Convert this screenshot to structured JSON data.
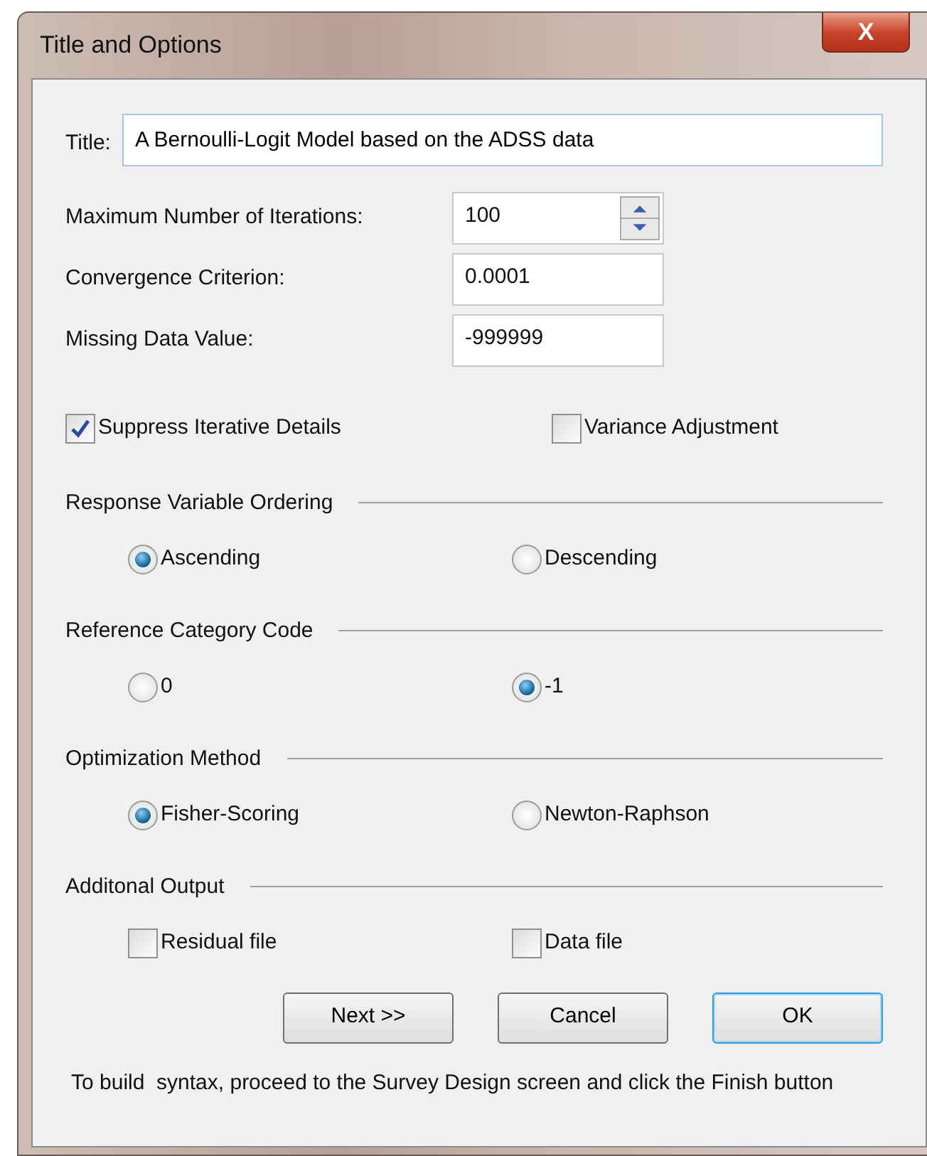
{
  "window": {
    "title": "Title and Options",
    "close_label": "X"
  },
  "title_field": {
    "label": "Title:",
    "value": "A Bernoulli-Logit Model based on the ADSS data"
  },
  "fields": [
    {
      "label": "Maximum Number of Iterations:",
      "value": "100",
      "kind": "spinner"
    },
    {
      "label": "Convergence Criterion:",
      "value": "0.0001",
      "kind": "text"
    },
    {
      "label": "Missing Data Value:",
      "value": "-999999",
      "kind": "text"
    }
  ],
  "options": [
    {
      "label": "Suppress Iterative Details",
      "checked": true
    },
    {
      "label": "Variance Adjustment",
      "checked": false
    }
  ],
  "groups": [
    {
      "title": "Response Variable Ordering",
      "kind": "radio",
      "items": [
        {
          "label": "Ascending",
          "selected": true
        },
        {
          "label": "Descending",
          "selected": false
        }
      ]
    },
    {
      "title": "Reference Category Code",
      "kind": "radio",
      "items": [
        {
          "label": "0",
          "selected": false
        },
        {
          "label": "-1",
          "selected": true
        }
      ]
    },
    {
      "title": "Optimization Method",
      "kind": "radio",
      "items": [
        {
          "label": "Fisher-Scoring",
          "selected": true
        },
        {
          "label": "Newton-Raphson",
          "selected": false
        }
      ]
    },
    {
      "title": "Additonal Output",
      "kind": "checkbox",
      "items": [
        {
          "label": "Residual file",
          "checked": false
        },
        {
          "label": "Data file",
          "checked": false
        }
      ]
    }
  ],
  "buttons": [
    {
      "label": "Next >>",
      "default": false
    },
    {
      "label": "Cancel",
      "default": false
    },
    {
      "label": "OK",
      "default": true
    }
  ],
  "note": "To build  syntax, proceed to the Survey Design screen and click the Finish button"
}
